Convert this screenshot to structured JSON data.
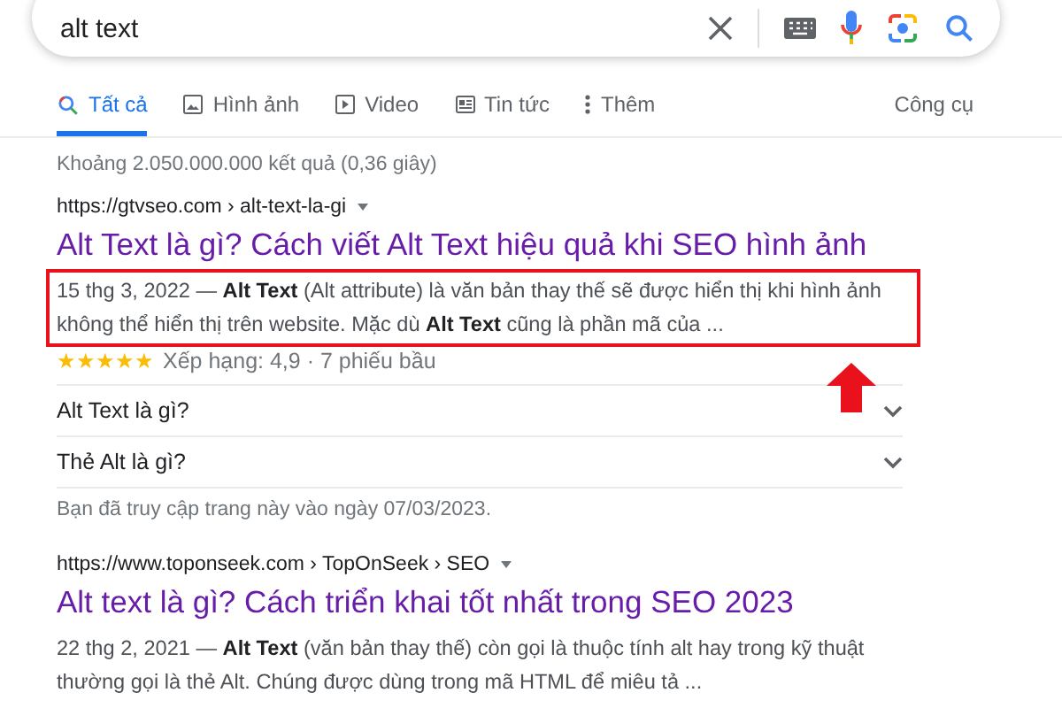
{
  "search": {
    "value": "alt text"
  },
  "tabs": [
    {
      "label": "Tất cả",
      "kind": "search",
      "selected": true
    },
    {
      "label": "Hình ảnh",
      "kind": "image",
      "selected": false
    },
    {
      "label": "Video",
      "kind": "play",
      "selected": false
    },
    {
      "label": "Tin tức",
      "kind": "news",
      "selected": false
    },
    {
      "label": "Thêm",
      "kind": "dots",
      "selected": false
    }
  ],
  "tools": "Công cụ",
  "result_count": "Khoảng 2.050.000.000 kết quả (0,36 giây)",
  "results": [
    {
      "url": "https://gtvseo.com › alt-text-la-gi",
      "title": "Alt Text là gì? Cách viết Alt Text hiệu quả khi SEO hình ảnh",
      "snippet": "15 thg 3, 2022 — **Alt Text** (Alt attribute) là văn bản thay thế sẽ được hiển thị khi hình ảnh không thể hiển thị trên website. Mặc dù **Alt Text** cũng là phần mã của ...",
      "highlighted": true,
      "stars": 5,
      "rating": "Xếp hạng: 4,9 · 7 phiếu bầu",
      "questions": [
        {
          "label": "Alt Text là gì?",
          "expanded": false
        },
        {
          "label": "Thẻ Alt là gì?",
          "expanded": false
        }
      ],
      "visited": "Bạn đã truy cập trang này vào ngày 07/03/2023."
    },
    {
      "url": "https://www.toponseek.com › TopOnSeek › SEO",
      "title": "Alt text là gì? Cách triển khai tốt nhất trong SEO 2023",
      "snippet": "22 thg 2, 2021 — **Alt Text** (văn bản thay thế) còn gọi là thuộc tính alt hay trong kỹ thuật thường gọi là thẻ Alt. Chúng được dùng trong mã HTML để miêu tả ...",
      "highlighted": false
    }
  ]
}
